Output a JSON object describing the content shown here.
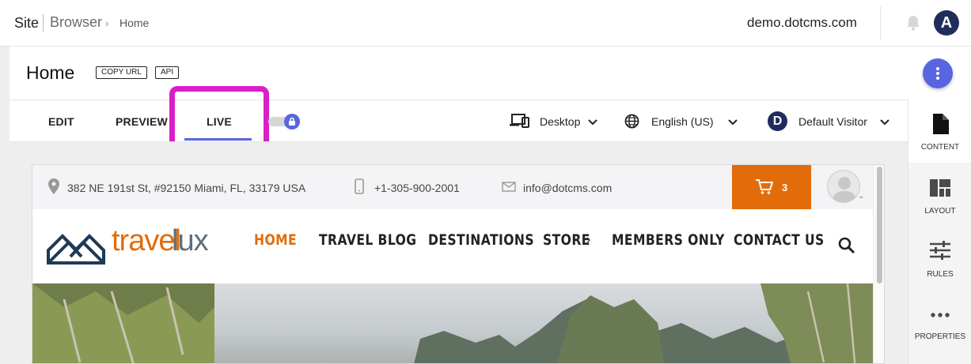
{
  "breadcrumb": {
    "site": "Site",
    "browser": "Browser",
    "chevron": "›",
    "current": "Home"
  },
  "header": {
    "site_name": "demo.dotcms.com",
    "avatar_initial": "A"
  },
  "page": {
    "title": "Home",
    "copy_url_label": "COPY URL",
    "api_label": "API"
  },
  "tabs": [
    {
      "label": "EDIT"
    },
    {
      "label": "PREVIEW"
    },
    {
      "label": "LIVE",
      "active": true
    }
  ],
  "toolbar": {
    "device": "Desktop",
    "language": "English (US)",
    "persona_initial": "D",
    "persona": "Default Visitor"
  },
  "sidebar": [
    {
      "label": "CONTENT",
      "icon": "document-icon"
    },
    {
      "label": "LAYOUT",
      "icon": "layout-icon"
    },
    {
      "label": "RULES",
      "icon": "sliders-icon"
    },
    {
      "label": "PROPERTIES",
      "icon": "more-horiz-icon"
    }
  ],
  "preview_site": {
    "address": "382 NE 191st St, #92150 Miami, FL, 33179 USA",
    "phone": "+1-305-900-2001",
    "email": "info@dotcms.com",
    "cart_count": "3",
    "logo_part1": "travel",
    "logo_part2": "lux",
    "nav": [
      "HOME",
      "TRAVEL BLOG",
      "DESTINATIONS",
      "STORE",
      "MEMBERS ONLY",
      "CONTACT US"
    ],
    "store_chevron": "›"
  },
  "colors": {
    "accent": "#5865e0",
    "highlight": "#d91fc8",
    "brand_orange": "#e36c0a",
    "navy": "#1f2d5c"
  }
}
